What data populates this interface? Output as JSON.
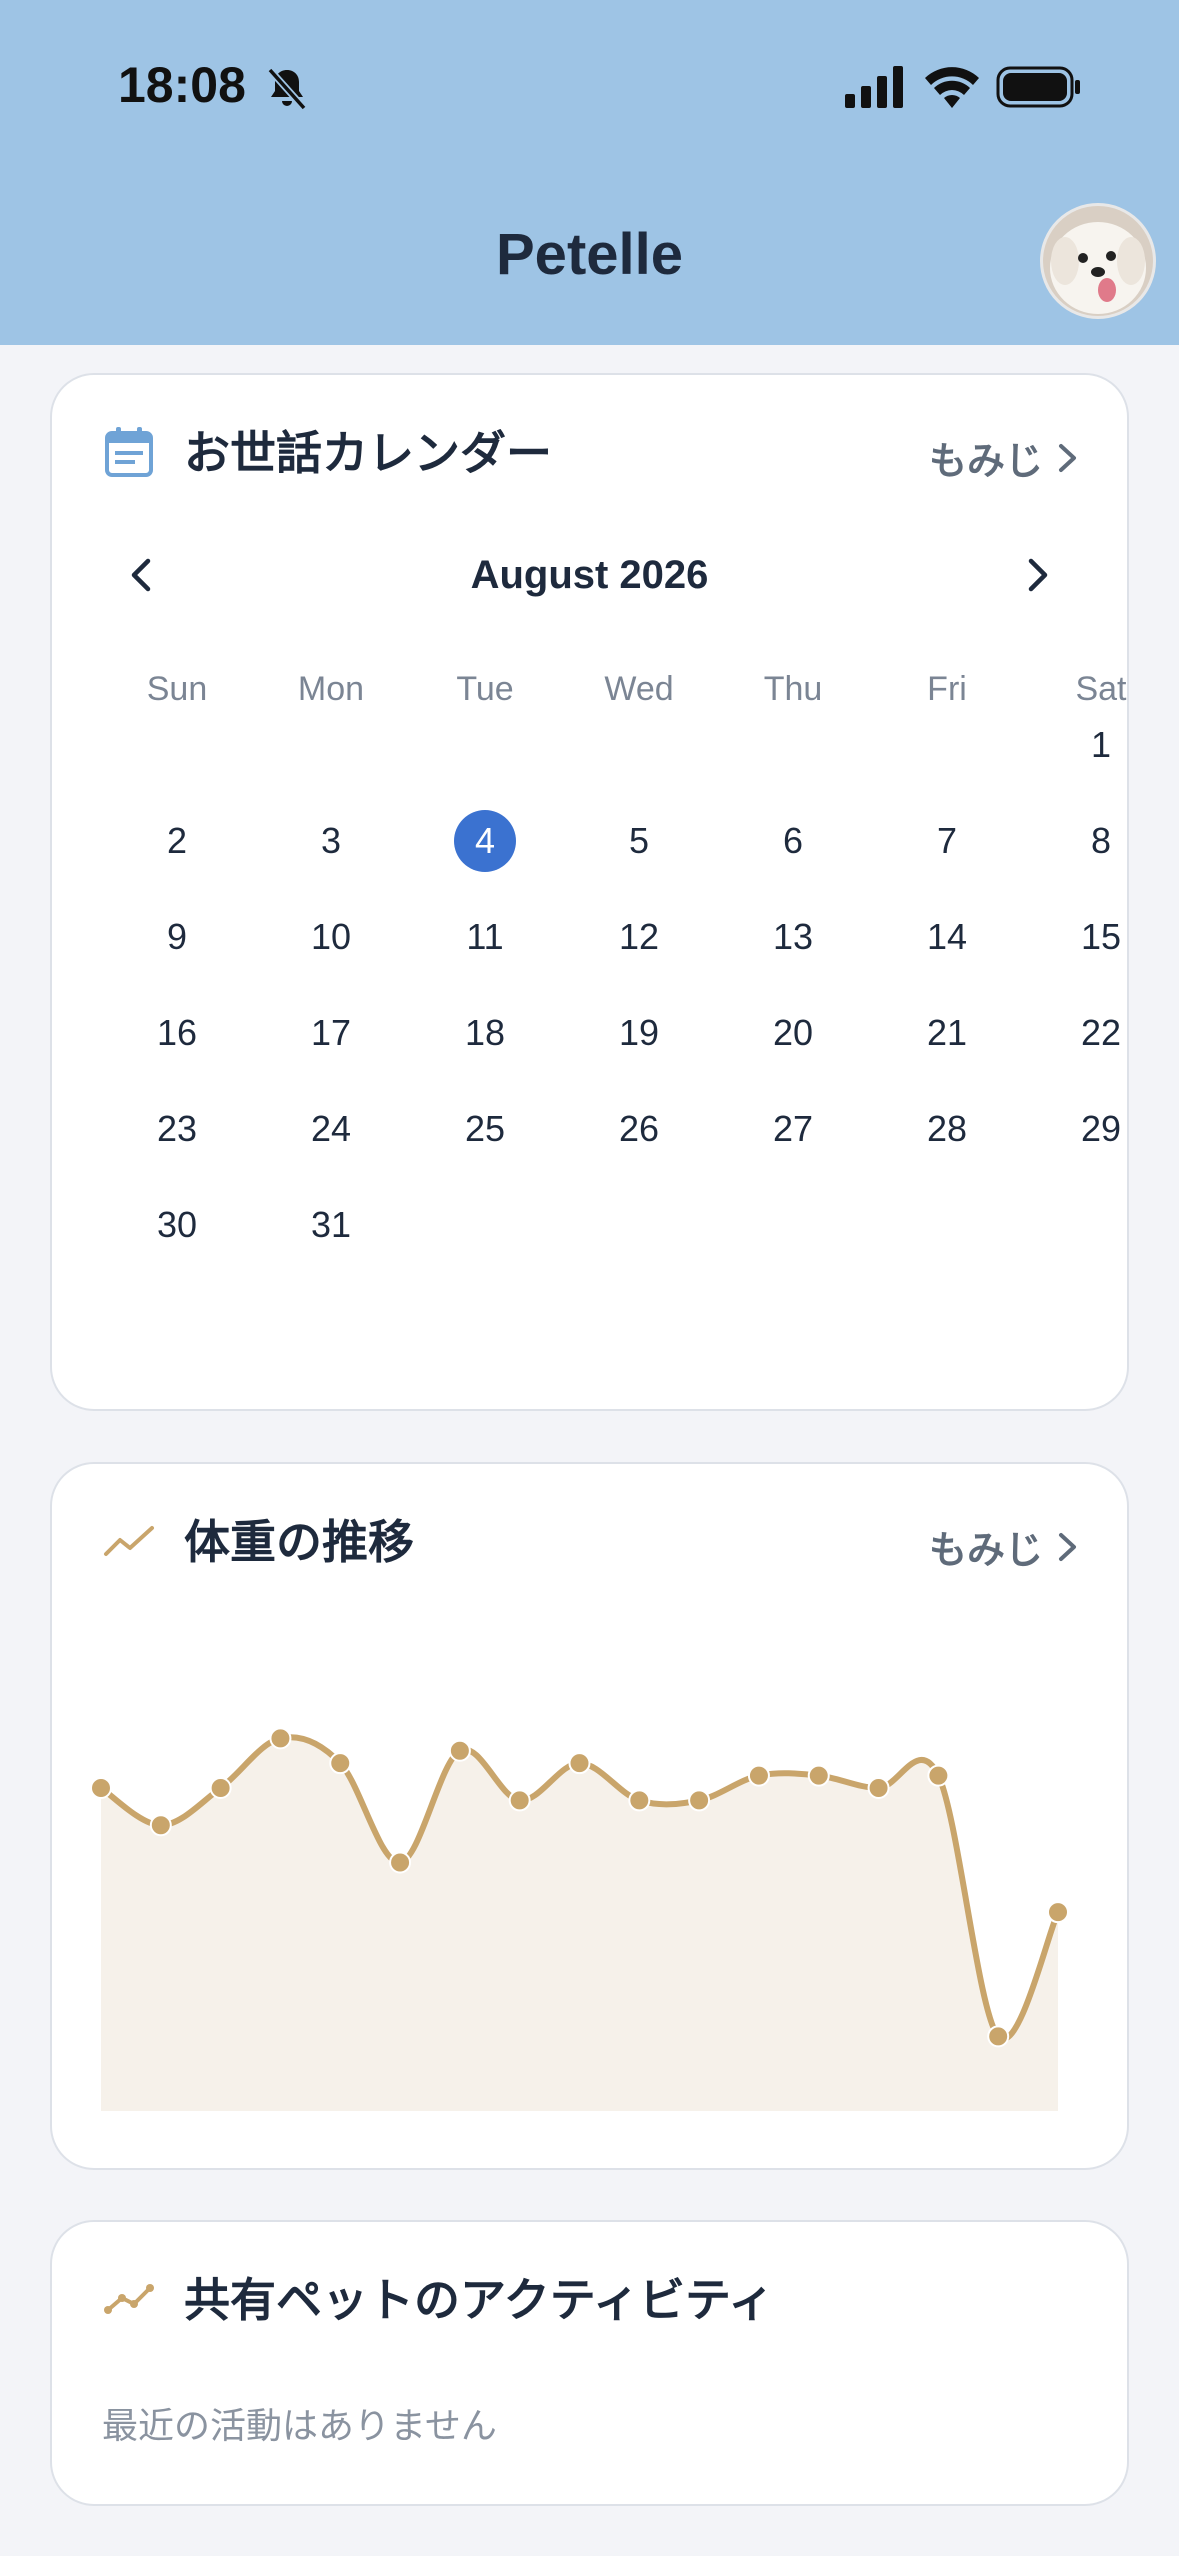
{
  "status_bar": {
    "time": "18:08"
  },
  "header": {
    "title": "Petelle",
    "avatar_alt": "pet avatar"
  },
  "calendar_card": {
    "title": "お世話カレンダー",
    "pet_link": "もみじ",
    "month_label": "August 2026",
    "weekdays": [
      "Sun",
      "Mon",
      "Tue",
      "Wed",
      "Thu",
      "Fri",
      "Sat"
    ],
    "weeks": [
      [
        "",
        "",
        "",
        "",
        "",
        "",
        "1"
      ],
      [
        "2",
        "3",
        "4",
        "5",
        "6",
        "7",
        "8"
      ],
      [
        "9",
        "10",
        "11",
        "12",
        "13",
        "14",
        "15"
      ],
      [
        "16",
        "17",
        "18",
        "19",
        "20",
        "21",
        "22"
      ],
      [
        "23",
        "24",
        "25",
        "26",
        "27",
        "28",
        "29"
      ],
      [
        "30",
        "31",
        "",
        "",
        "",
        "",
        ""
      ]
    ],
    "today": "4"
  },
  "weight_card": {
    "title": "体重の推移",
    "pet_link": "もみじ"
  },
  "activity_card": {
    "title": "共有ペットのアクティビティ",
    "empty_message": "最近の活動はありません"
  },
  "colors": {
    "header_bg": "#9ec4e5",
    "accent_blue": "#3b72d0",
    "chart_line": "#c9a56b",
    "chart_fill": "#f6f1ea"
  },
  "chart_data": {
    "type": "area",
    "values": [
      70,
      68.5,
      70,
      72,
      71,
      67,
      71.5,
      69.5,
      71,
      69.5,
      69.5,
      70.5,
      70.5,
      70,
      70.5,
      60,
      65
    ],
    "ylim": [
      58,
      76
    ]
  }
}
